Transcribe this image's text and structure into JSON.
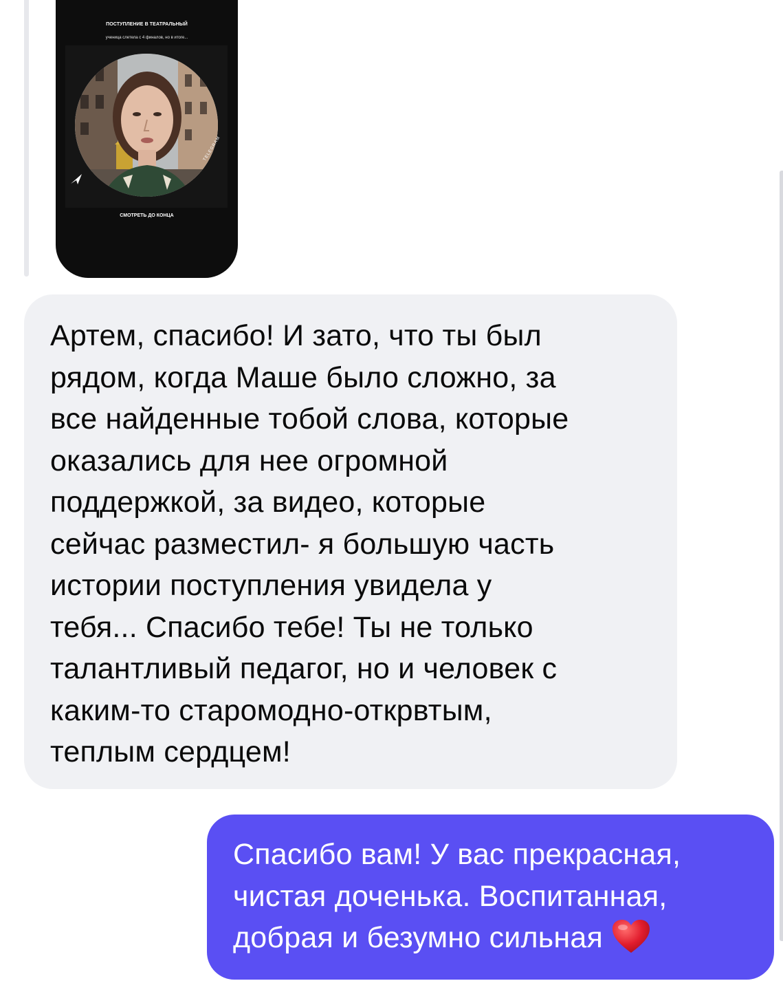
{
  "story": {
    "title": "ПОСТУПЛЕНИЕ В ТЕАТРАЛЬНЫЙ",
    "subtitle": "ученица слетела с 4 финалов, но в итоге...",
    "cta": "СМОТРЕТЬ ДО КОНЦА",
    "watermark": "TELEGRAM",
    "icons": [
      "telegram-arrow-icon"
    ]
  },
  "messages": {
    "incoming": {
      "text": "Артем, спасибо! И зато, что ты был\nрядом, когда Маше было сложно, за\nвсе  найденные тобой слова, которые\nоказались для нее огромной\nподдержкой, за видео, которые\nсейчас разместил- я большую часть\nистории поступления увидела у\nтебя... Спасибо тебе! Ты не только\nталантливый педагог, но и человек с\nкаким-то старомодно-открвтым,\nтеплым сердцем!"
    },
    "outgoing": {
      "text": "Спасибо вам! У вас прекрасная,\nчистая доченька. Воспитанная,\nдобрая и безумно сильная",
      "emoji": "heart-emoji"
    }
  },
  "colors": {
    "incoming_bubble": "#f0f1f4",
    "outgoing_bubble": "#5a4ff3",
    "outgoing_text": "#ffffff",
    "heart": "#e11d2e"
  }
}
